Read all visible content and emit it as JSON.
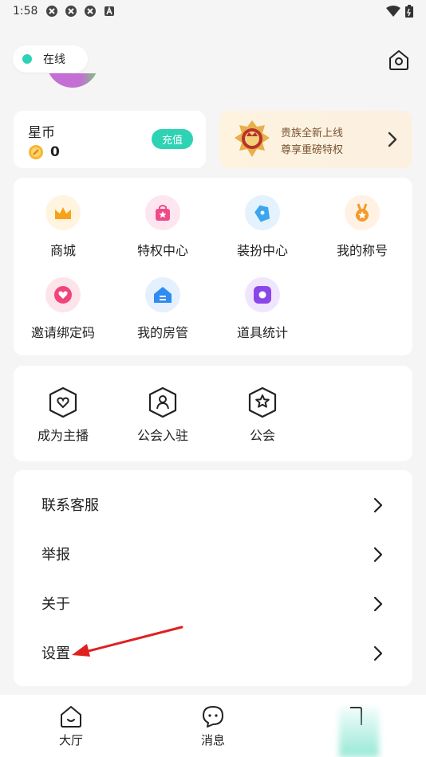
{
  "status_bar": {
    "time": "1:58"
  },
  "header": {
    "online_label": "在线"
  },
  "coins": {
    "title": "星币",
    "value": "0",
    "recharge_label": "充值"
  },
  "noble": {
    "line1": "贵族全新上线",
    "line2": "尊享重磅特权"
  },
  "features": [
    {
      "label": "商城",
      "icon": "crown-icon",
      "color": "#f7a21b"
    },
    {
      "label": "特权中心",
      "icon": "gift-bag-icon",
      "color": "#f04a8b"
    },
    {
      "label": "装扮中心",
      "icon": "shirt-icon",
      "color": "#3ba6f0"
    },
    {
      "label": "我的称号",
      "icon": "medal-icon",
      "color": "#f39a2a"
    },
    {
      "label": "邀请绑定码",
      "icon": "heart-icon",
      "color": "#f0447a"
    },
    {
      "label": "我的房管",
      "icon": "house-icon",
      "color": "#2f8cf0"
    },
    {
      "label": "道具统计",
      "icon": "box-icon",
      "color": "#8a46e8"
    }
  ],
  "guild": [
    {
      "label": "成为主播",
      "icon": "heart-shield-icon"
    },
    {
      "label": "公会入驻",
      "icon": "person-shield-icon"
    },
    {
      "label": "公会",
      "icon": "star-shield-icon"
    }
  ],
  "menu": [
    {
      "label": "联系客服"
    },
    {
      "label": "举报"
    },
    {
      "label": "关于"
    },
    {
      "label": "设置"
    }
  ],
  "bottom_nav": [
    {
      "label": "大厅",
      "icon": "home-smile-icon"
    },
    {
      "label": "消息",
      "icon": "chat-bubble-icon"
    },
    {
      "label": "",
      "icon": "profile-tab-icon"
    }
  ],
  "colors": {
    "accent": "#2ed3b4",
    "background": "#f5f5f5",
    "annotation": "#e02020"
  }
}
